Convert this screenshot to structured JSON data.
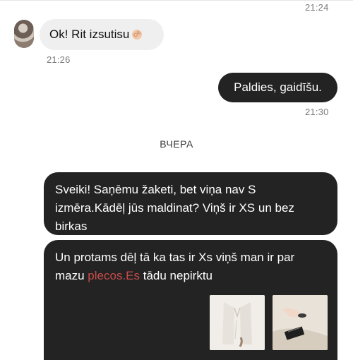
{
  "messages": {
    "top_time": "21:24",
    "incoming": {
      "text": "Ok! Rit izsutisu",
      "time": "21:26"
    },
    "outgoing_short": {
      "text": "Paldies, gaidīšu.",
      "time": "21:30"
    },
    "date_separator": "ВЧЕРА",
    "outgoing_long_1": {
      "text": "Sveiki! Saņēmu žaketi, bet viņa nav S izmēra.Kādēļ jūs maldinat? Viņš ir XS un bez birkas"
    },
    "outgoing_long_2": {
      "text_before": "Un protams dēļ tā ka tas ir Xs viņš man ir par mazu ",
      "highlight": "plecos.Es",
      "text_after": " tādu nepirktu"
    }
  },
  "colors": {
    "incoming_bubble": "#efefef",
    "outgoing_bubble": "#232323",
    "accent_text": "#c94a4a",
    "timestamp": "#7a7a7a"
  },
  "icons": {
    "emoji": "ok-hand-icon"
  }
}
